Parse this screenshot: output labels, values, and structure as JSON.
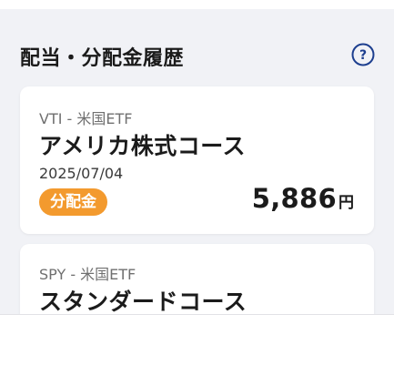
{
  "section": {
    "title": "配当・分配金履歴",
    "help_icon": "question-circle-icon"
  },
  "cards": [
    {
      "fund": "VTI - 米国ETF",
      "course": "アメリカ株式コース",
      "date": "2025/07/04",
      "badge": "分配金",
      "amount": "5,886",
      "unit": "円"
    },
    {
      "fund": "SPY - 米国ETF",
      "course": "スタンダードコース"
    }
  ],
  "colors": {
    "background": "#f1f2f6",
    "card": "#ffffff",
    "badge": "#f39a2e",
    "help_icon": "#1d3f8f"
  }
}
